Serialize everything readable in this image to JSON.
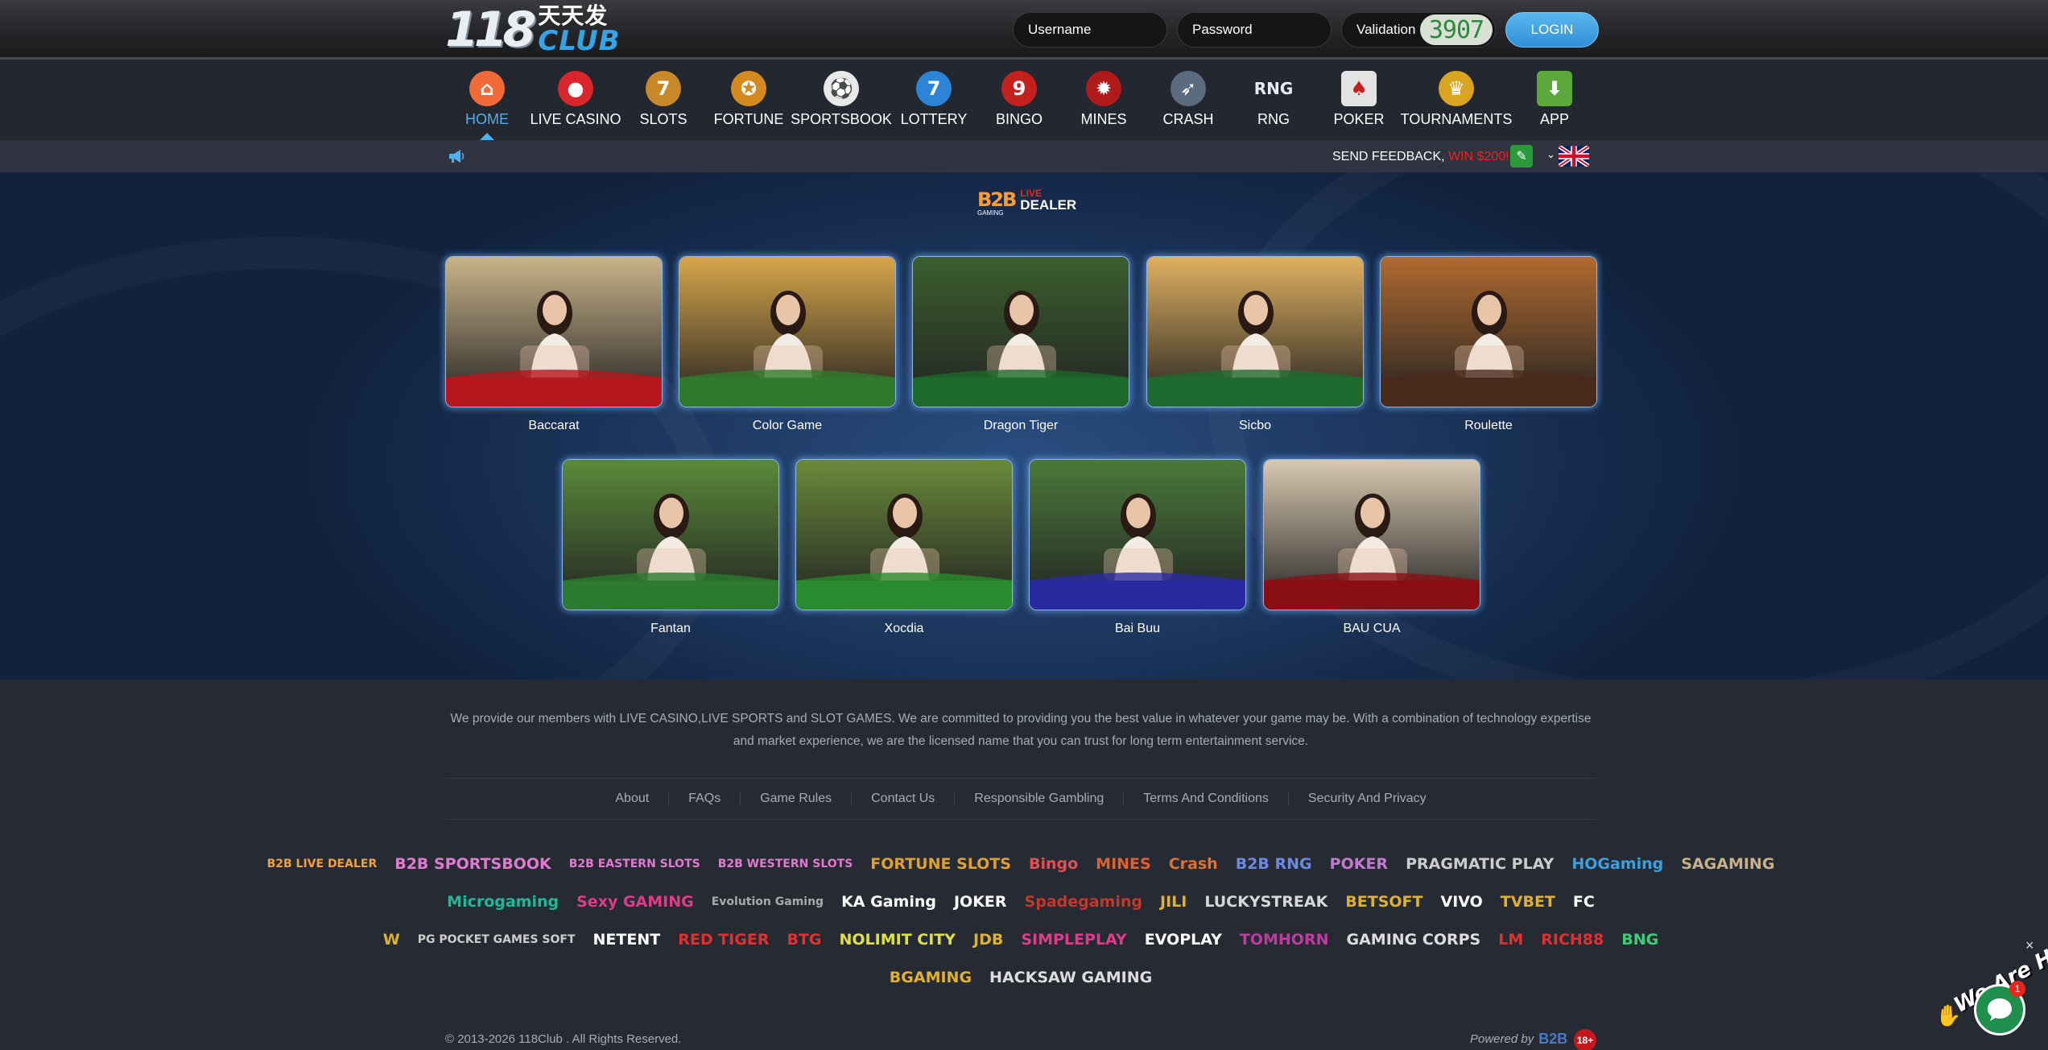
{
  "header": {
    "logo_number": "118",
    "logo_chinese": "天天发",
    "logo_club": "CLUB",
    "username_placeholder": "Username",
    "password_placeholder": "Password",
    "validation_label": "Validation",
    "validation_code": "3907",
    "login_label": "LOGIN"
  },
  "nav": {
    "items": [
      {
        "label": "HOME",
        "icon": "home-icon",
        "active": true
      },
      {
        "label": "LIVE CASINO",
        "icon": "casino-chip-icon"
      },
      {
        "label": "SLOTS",
        "icon": "slot-machine-icon"
      },
      {
        "label": "FORTUNE",
        "icon": "fortune-coin-icon"
      },
      {
        "label": "SPORTSBOOK",
        "icon": "soccer-ball-icon"
      },
      {
        "label": "LOTTERY",
        "icon": "lottery-ball-icon"
      },
      {
        "label": "BINGO",
        "icon": "bingo-ball-icon"
      },
      {
        "label": "MINES",
        "icon": "mine-icon"
      },
      {
        "label": "CRASH",
        "icon": "rocket-icon"
      },
      {
        "label": "RNG",
        "icon": "rng-icon"
      },
      {
        "label": "POKER",
        "icon": "poker-cards-icon"
      },
      {
        "label": "TOURNAMENTS",
        "icon": "trophy-icon"
      },
      {
        "label": "APP",
        "icon": "download-icon"
      }
    ]
  },
  "notice": {
    "feedback_text": "SEND FEEDBACK, ",
    "feedback_win": "WIN $200!"
  },
  "brand": {
    "b2b": "B2B",
    "gaming": "GAMING",
    "live": "LIVE",
    "dealer": "DEALER"
  },
  "games": [
    {
      "name": "Baccarat",
      "table": "#b5171d"
    },
    {
      "name": "Color Game",
      "table": "#2f7a2c"
    },
    {
      "name": "Dragon Tiger",
      "table": "#1d6a2a"
    },
    {
      "name": "Sicbo",
      "table": "#1f6a2e"
    },
    {
      "name": "Roulette",
      "table": "#4a2a1d"
    },
    {
      "name": "Fantan",
      "table": "#2b7a2f"
    },
    {
      "name": "Xocdia",
      "table": "#2a8a2e"
    },
    {
      "name": "Bai Buu",
      "table": "#2a2aa0"
    },
    {
      "name": "BAU CUA",
      "table": "#8a0f14"
    }
  ],
  "footer": {
    "about": "We provide our members with LIVE CASINO,LIVE SPORTS and SLOT GAMES. We are committed to providing you the best value in whatever your game may be. With a combination of technology expertise and market experience, we are the licensed name that you can trust for long term entertainment service.",
    "links": [
      "About",
      "FAQs",
      "Game Rules",
      "Contact Us",
      "Responsible Gambling",
      "Terms And Conditions",
      "Security And Privacy"
    ],
    "providers": [
      [
        {
          "name": "B2B LIVE DEALER",
          "color": "#f0a040"
        },
        {
          "name": "B2B SPORTSBOOK",
          "color": "#e07ad0"
        },
        {
          "name": "B2B EASTERN SLOTS",
          "color": "#e07ad0"
        },
        {
          "name": "B2B WESTERN SLOTS",
          "color": "#e07ad0"
        },
        {
          "name": "FORTUNE SLOTS",
          "color": "#e0a030"
        },
        {
          "name": "Bingo",
          "color": "#e05050"
        },
        {
          "name": "MINES",
          "color": "#e06030"
        },
        {
          "name": "Crash",
          "color": "#e07030"
        },
        {
          "name": "B2B RNG",
          "color": "#6a8ae0"
        },
        {
          "name": "POKER",
          "color": "#c07ad0"
        },
        {
          "name": "PRAGMATIC PLAY",
          "color": "#cccccc"
        },
        {
          "name": "HOGaming",
          "color": "#3aa0e0"
        },
        {
          "name": "SAGAMING",
          "color": "#c8b08a"
        }
      ],
      [
        {
          "name": "Microgaming",
          "color": "#1fb89a"
        },
        {
          "name": "Sexy GAMING",
          "color": "#e03a8a"
        },
        {
          "name": "Evolution Gaming",
          "color": "#aaaaaa"
        },
        {
          "name": "KA Gaming",
          "color": "#ffffff"
        },
        {
          "name": "JOKER",
          "color": "#ffffff"
        },
        {
          "name": "Spadegaming",
          "color": "#c0392b"
        },
        {
          "name": "JILI",
          "color": "#e0b030"
        },
        {
          "name": "LUCKYSTREAK",
          "color": "#d8d8d8"
        },
        {
          "name": "BETSOFT",
          "color": "#e0b030"
        },
        {
          "name": "VIVO",
          "color": "#ffffff"
        },
        {
          "name": "TVBET",
          "color": "#e0b030"
        },
        {
          "name": "FC",
          "color": "#ffffff"
        }
      ],
      [
        {
          "name": "W",
          "color": "#e0b030"
        },
        {
          "name": "PG POCKET GAMES SOFT",
          "color": "#cccccc"
        },
        {
          "name": "NETENT",
          "color": "#ffffff"
        },
        {
          "name": "RED TIGER",
          "color": "#e03030"
        },
        {
          "name": "BTG",
          "color": "#e03030"
        },
        {
          "name": "NOLIMIT CITY",
          "color": "#e0e040"
        },
        {
          "name": "JDB",
          "color": "#e0b030"
        },
        {
          "name": "SIMPLEPLAY",
          "color": "#e03a8a"
        },
        {
          "name": "EVOPLAY",
          "color": "#ffffff"
        },
        {
          "name": "TOMHORN",
          "color": "#c03aa0"
        },
        {
          "name": "GAMING CORPS",
          "color": "#dddddd"
        },
        {
          "name": "LM",
          "color": "#e03030"
        },
        {
          "name": "RICH88",
          "color": "#e03030"
        },
        {
          "name": "BNG",
          "color": "#3ad07a"
        }
      ],
      [
        {
          "name": "BGAMING",
          "color": "#e0b030"
        },
        {
          "name": "HACKSAW GAMING",
          "color": "#dddddd"
        }
      ]
    ],
    "copyright": "© 2013-2026 118Club . All Rights Reserved.",
    "powered_by": "Powered by",
    "powered_brand": "B2B",
    "age_badge": "18+"
  },
  "chat": {
    "banner": "We Are Here!",
    "badge": "1",
    "close": "×"
  }
}
